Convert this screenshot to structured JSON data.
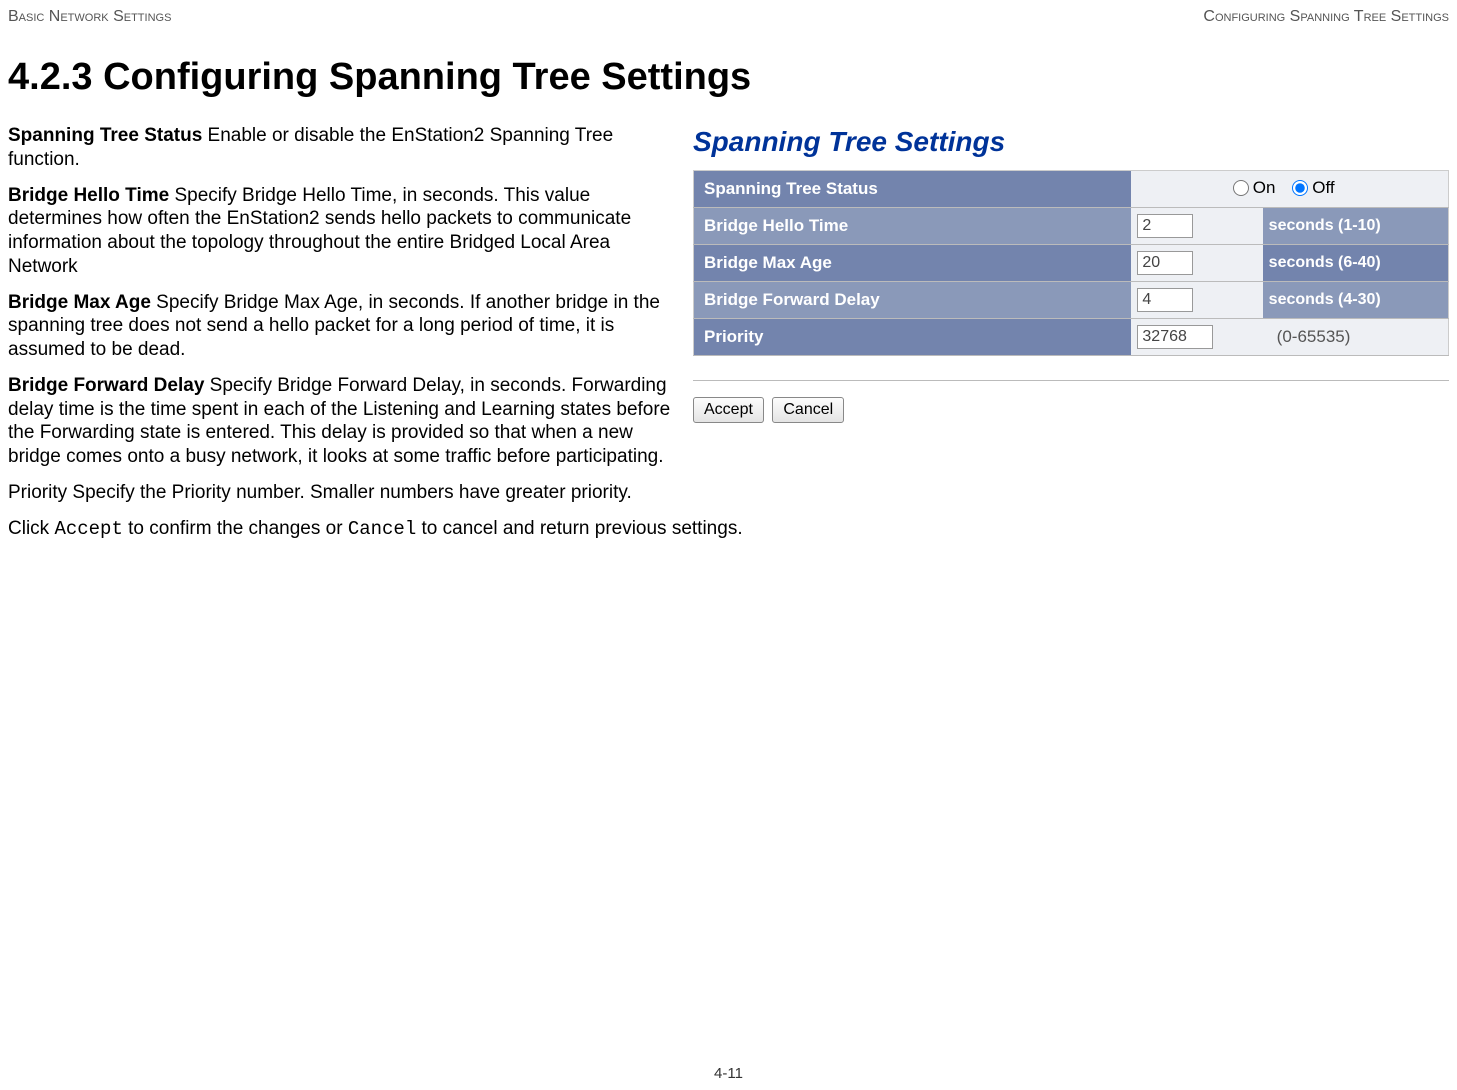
{
  "header": {
    "left": "Basic Network Settings",
    "right": "Configuring Spanning Tree Settings"
  },
  "heading": "4.2.3 Configuring Spanning Tree Settings",
  "paragraphs": {
    "p1_term": "Spanning Tree Status",
    "p1_body": "  Enable or disable the EnStation2 Spanning Tree function.",
    "p2_term": "Bridge Hello Time",
    "p2_body": "  Specify Bridge Hello Time, in seconds. This value determines how often the EnStation2 sends hello packets to communicate information about the topology throughout the entire Bridged Local Area Network",
    "p3_term": "Bridge Max Age",
    "p3_body": "  Specify Bridge Max Age, in seconds. If another bridge in the spanning tree does not send a hello packet for a long period of time, it is assumed to be dead.",
    "p4_term": "Bridge Forward Delay",
    "p4_body": "  Specify Bridge Forward Delay, in seconds. Forwarding delay time is the time spent in each of the Listening and Learning states before the Forwarding state is entered. This delay is provided so that when a new bridge comes onto a busy network, it looks at some traffic before participating.",
    "p5_term": "Priority",
    "p5_body": "  Specify the Priority number. Smaller numbers have greater priority.",
    "p6_pre": "Click ",
    "p6_accept": "Accept",
    "p6_mid": " to confirm the changes or ",
    "p6_cancel": "Cancel",
    "p6_post": " to cancel and return previous settings."
  },
  "panel": {
    "title": "Spanning Tree Settings",
    "rows": {
      "status_label": "Spanning Tree Status",
      "on_label": "On",
      "off_label": "Off",
      "hello_label": "Bridge Hello Time",
      "hello_value": "2",
      "hello_unit": "seconds (1-10)",
      "maxage_label": "Bridge Max Age",
      "maxage_value": "20",
      "maxage_unit": "seconds (6-40)",
      "fwd_label": "Bridge Forward Delay",
      "fwd_value": "4",
      "fwd_unit": "seconds (4-30)",
      "priority_label": "Priority",
      "priority_value": "32768",
      "priority_range": "(0-65535)"
    },
    "buttons": {
      "accept": "Accept",
      "cancel": "Cancel"
    }
  },
  "footer": "4-11"
}
